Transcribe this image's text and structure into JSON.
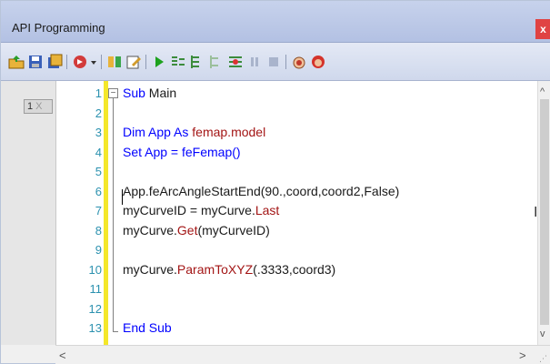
{
  "window": {
    "title": "API Programming",
    "close_label": "x"
  },
  "toolbar": {
    "icons": [
      "open-folder-icon",
      "save-icon",
      "save-all-icon",
      "run-macro-icon",
      "dropdown-arrow-icon",
      "references-icon",
      "edit-icon",
      "play-icon",
      "step-into-icon",
      "step-over-icon",
      "step-out-icon",
      "toggle-breakpoint-icon",
      "pause-icon",
      "stop-icon",
      "hand-icon",
      "stop-hand-icon"
    ]
  },
  "tab": {
    "label": "1",
    "close": "X"
  },
  "editor": {
    "line_numbers": [
      "1",
      "2",
      "3",
      "4",
      "5",
      "6",
      "7",
      "8",
      "9",
      "10",
      "11",
      "12",
      "13"
    ],
    "fold_toggle": "−",
    "lines": [
      {
        "kw": "Sub",
        "rest": " Main"
      },
      {
        "plain": ""
      },
      {
        "plain": "Dim App As ",
        "type": "femap.model"
      },
      {
        "plain": "Set App = feFemap()"
      },
      {
        "plain": ""
      },
      {
        "plain": "App.feArcAngleStartEnd(90.,coord,coord2,False)"
      },
      {
        "plain": "myCurveID = myCurve.",
        "type": "Last"
      },
      {
        "plain": "myCurve.",
        "type": "Get",
        "rest": "(myCurveID)"
      },
      {
        "plain": ""
      },
      {
        "plain": "myCurve.",
        "type": "ParamToXYZ",
        "rest": "(.3333,coord3)"
      },
      {
        "plain": ""
      },
      {
        "plain": ""
      },
      {
        "kw": "End Sub"
      }
    ]
  },
  "colors": {
    "line_number": "#2b91af",
    "changebar": "#f4e72a",
    "keyword": "#0000ff",
    "member": "#a31515"
  },
  "scrollbars": {
    "up": "^",
    "down": "v",
    "left": "<",
    "right": ">"
  }
}
